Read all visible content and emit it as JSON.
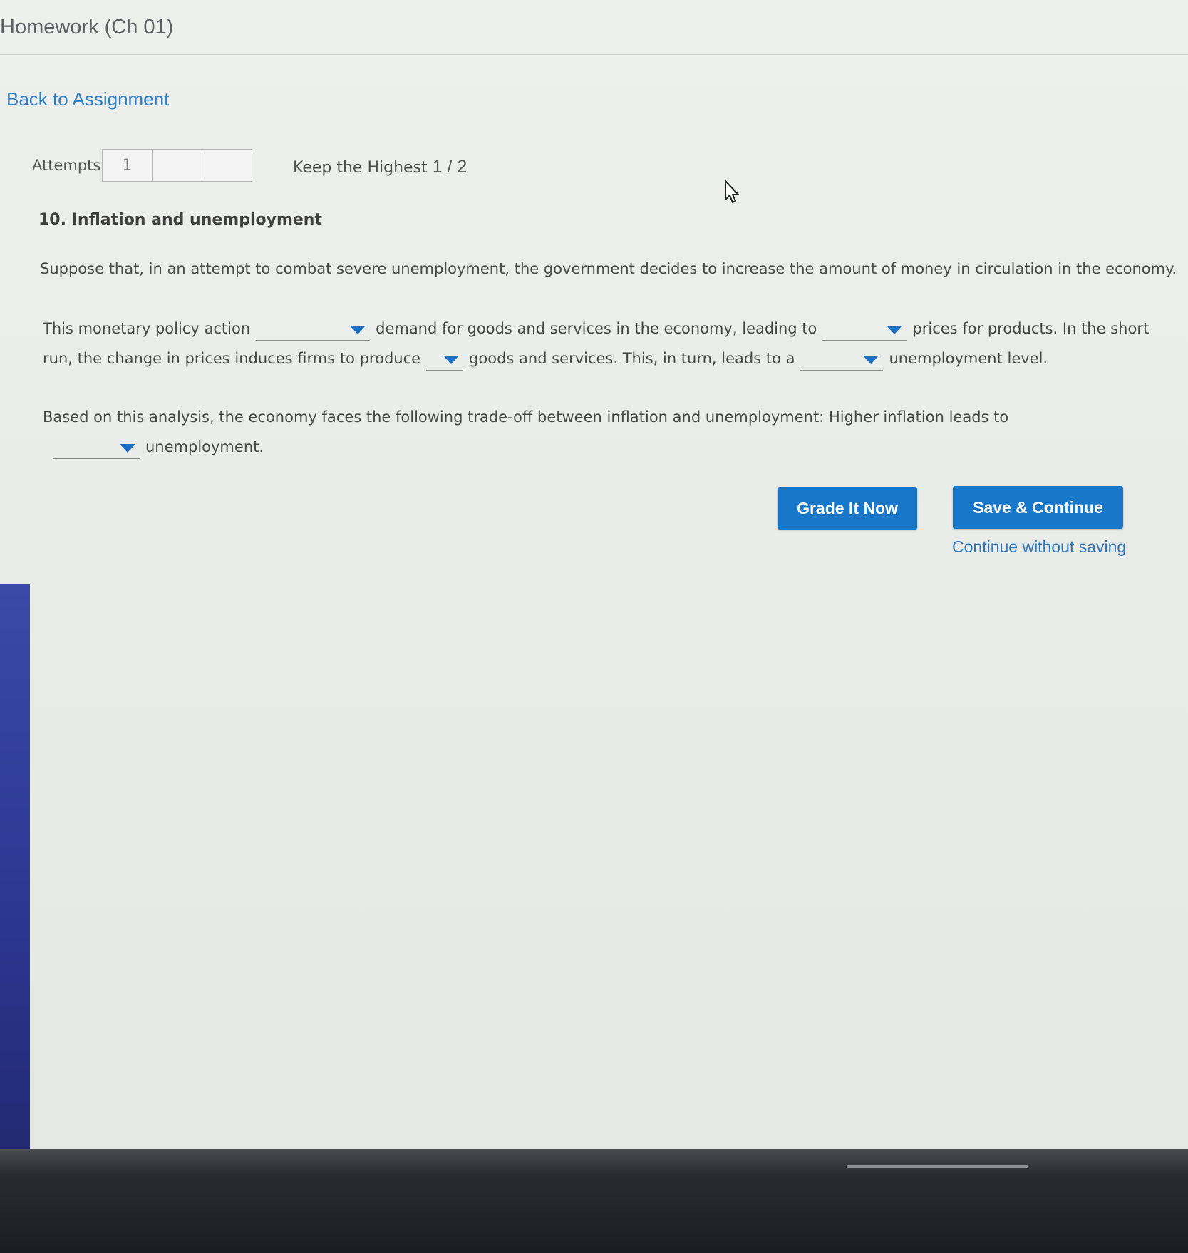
{
  "header": {
    "title": "Homework (Ch 01)"
  },
  "nav": {
    "back_link": "Back to Assignment"
  },
  "attempts": {
    "label": "Attempts",
    "boxes": [
      "1",
      "",
      ""
    ],
    "keep_label": "Keep the Highest",
    "score": "1 / 2"
  },
  "question": {
    "title": "10. Inflation and unemployment",
    "intro": "Suppose that, in an attempt to combat severe unemployment, the government decides to increase the amount of money in circulation in the economy.",
    "para1": {
      "t1": "This monetary policy action",
      "t2": "demand for goods and services in the economy, leading to",
      "t3": "prices for products. In the short run, the change in prices induces firms to produce",
      "t4": "goods and services. This, in turn, leads to a",
      "t5": "unemployment level."
    },
    "para2": {
      "t1": "Based on this analysis, the economy faces the following trade-off between inflation and unemployment: Higher inflation leads to",
      "t2": "unemployment."
    },
    "dropdowns": [
      "",
      "",
      "",
      "",
      ""
    ]
  },
  "buttons": {
    "grade": "Grade It Now",
    "save": "Save & Continue",
    "continue_without_saving": "Continue without saving"
  },
  "colors": {
    "accent": "#1877c9",
    "link": "#2c7cc2",
    "dropdown_arrow": "#1d6fc4"
  }
}
